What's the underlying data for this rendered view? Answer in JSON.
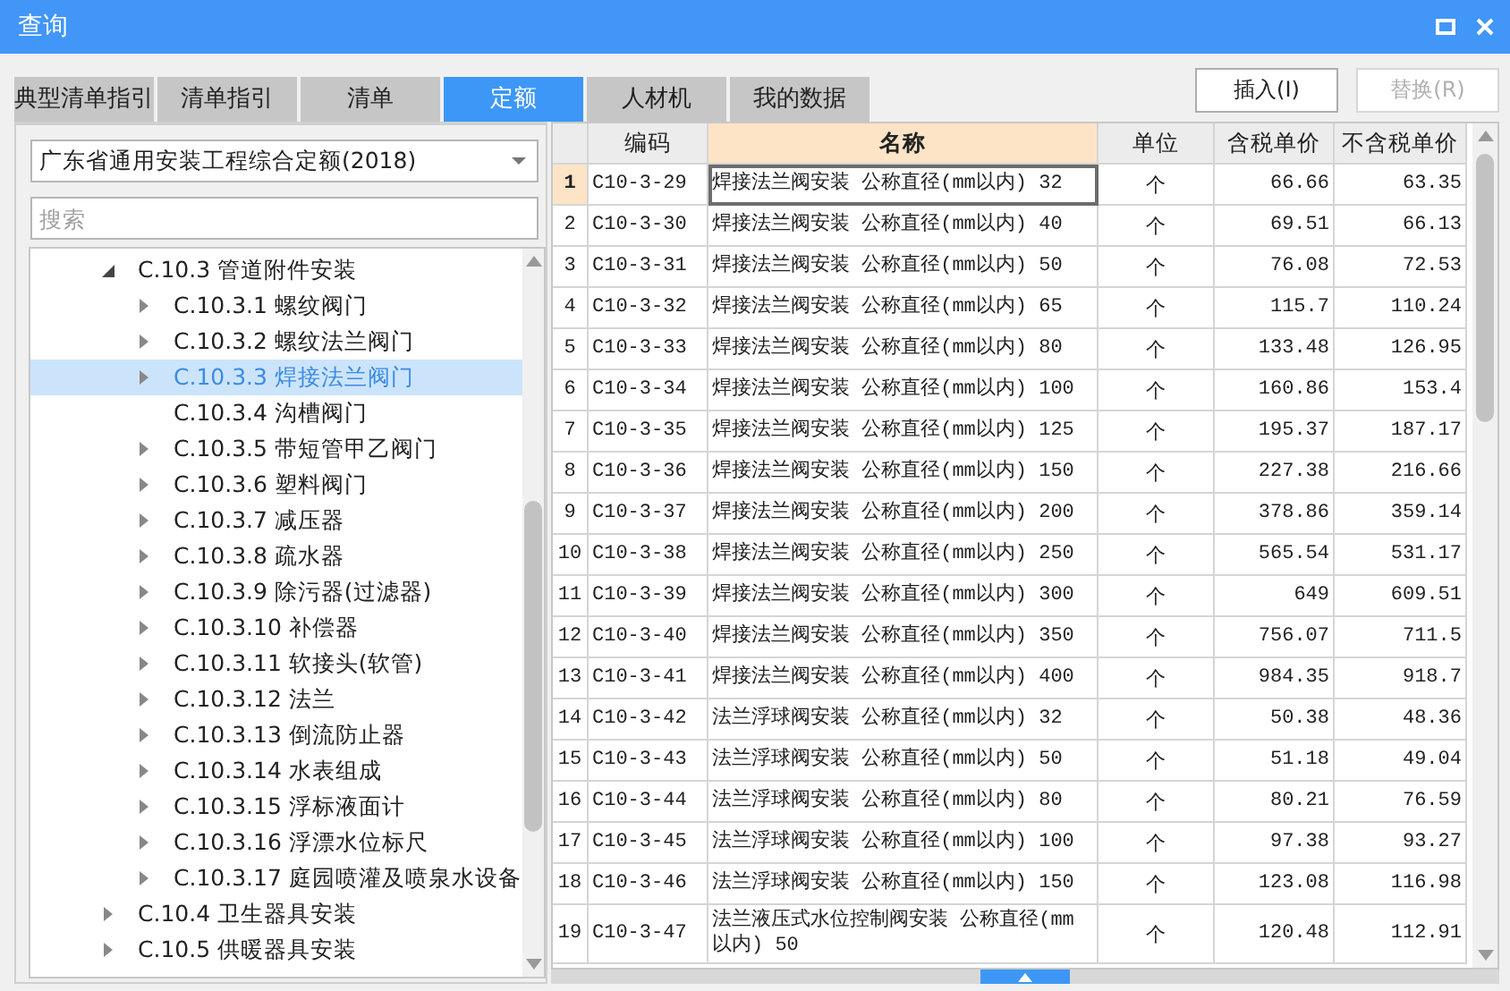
{
  "window": {
    "title": "查询"
  },
  "tabs": [
    {
      "label": "典型清单指引",
      "selected": false
    },
    {
      "label": "清单指引",
      "selected": false
    },
    {
      "label": "清单",
      "selected": false
    },
    {
      "label": "定额",
      "selected": true
    },
    {
      "label": "人材机",
      "selected": false
    },
    {
      "label": "我的数据",
      "selected": false
    }
  ],
  "buttons": [
    {
      "label": "插入(I)",
      "disabled": false
    },
    {
      "label": "替换(R)",
      "disabled": true
    }
  ],
  "library_select": {
    "value": "广东省通用安装工程综合定额(2018)"
  },
  "search": {
    "placeholder": "搜索"
  },
  "tree": [
    {
      "label": "C.10.3 管道附件安装",
      "expandable": true,
      "expanded": true,
      "selected": false,
      "children": [
        {
          "label": "C.10.3.1 螺纹阀门",
          "expandable": true,
          "expanded": false,
          "selected": false
        },
        {
          "label": "C.10.3.2 螺纹法兰阀门",
          "expandable": true,
          "expanded": false,
          "selected": false
        },
        {
          "label": "C.10.3.3 焊接法兰阀门",
          "expandable": true,
          "expanded": false,
          "selected": true
        },
        {
          "label": "C.10.3.4 沟槽阀门",
          "selected": false
        },
        {
          "label": "C.10.3.5 带短管甲乙阀门",
          "expandable": true,
          "expanded": false,
          "selected": false
        },
        {
          "label": "C.10.3.6 塑料阀门",
          "expandable": true,
          "expanded": false,
          "selected": false
        },
        {
          "label": "C.10.3.7 减压器",
          "expandable": true,
          "expanded": false,
          "selected": false
        },
        {
          "label": "C.10.3.8 疏水器",
          "expandable": true,
          "expanded": false,
          "selected": false
        },
        {
          "label": "C.10.3.9 除污器(过滤器)",
          "expandable": true,
          "expanded": false,
          "selected": false
        },
        {
          "label": "C.10.3.10 补偿器",
          "expandable": true,
          "expanded": false,
          "selected": false
        },
        {
          "label": "C.10.3.11 软接头(软管)",
          "expandable": true,
          "expanded": false,
          "selected": false
        },
        {
          "label": "C.10.3.12 法兰",
          "expandable": true,
          "expanded": false,
          "selected": false
        },
        {
          "label": "C.10.3.13 倒流防止器",
          "expandable": true,
          "expanded": false,
          "selected": false
        },
        {
          "label": "C.10.3.14 水表组成",
          "expandable": true,
          "expanded": false,
          "selected": false
        },
        {
          "label": "C.10.3.15 浮标液面计",
          "expandable": true,
          "expanded": false,
          "selected": false
        },
        {
          "label": "C.10.3.16 浮漂水位标尺",
          "expandable": true,
          "expanded": false,
          "selected": false
        },
        {
          "label": "C.10.3.17 庭园喷灌及喷泉水设备",
          "expandable": true,
          "expanded": false,
          "selected": false
        }
      ]
    },
    {
      "label": "C.10.4 卫生器具安装",
      "expandable": true,
      "expanded": false,
      "selected": false
    },
    {
      "label": "C.10.5 供暖器具安装",
      "expandable": true,
      "expanded": false,
      "selected": false
    }
  ],
  "table": {
    "columns": [
      {
        "label": "编码",
        "selected": false
      },
      {
        "label": "名称",
        "selected": true
      },
      {
        "label": "单位",
        "selected": false
      },
      {
        "label": "含税单价",
        "selected": false
      },
      {
        "label": "不含税单价",
        "selected": false
      }
    ],
    "rows": [
      {
        "number": "1",
        "code": "C10-3-29",
        "name": "焊接法兰阀安装 公称直径(mm以内) 32",
        "unit": "个",
        "price_tax": "66.66",
        "price_no_tax": "63.35",
        "selected": true
      },
      {
        "number": "2",
        "code": "C10-3-30",
        "name": "焊接法兰阀安装 公称直径(mm以内) 40",
        "unit": "个",
        "price_tax": "69.51",
        "price_no_tax": "66.13",
        "selected": false
      },
      {
        "number": "3",
        "code": "C10-3-31",
        "name": "焊接法兰阀安装 公称直径(mm以内) 50",
        "unit": "个",
        "price_tax": "76.08",
        "price_no_tax": "72.53",
        "selected": false
      },
      {
        "number": "4",
        "code": "C10-3-32",
        "name": "焊接法兰阀安装 公称直径(mm以内) 65",
        "unit": "个",
        "price_tax": "115.7",
        "price_no_tax": "110.24",
        "selected": false
      },
      {
        "number": "5",
        "code": "C10-3-33",
        "name": "焊接法兰阀安装 公称直径(mm以内) 80",
        "unit": "个",
        "price_tax": "133.48",
        "price_no_tax": "126.95",
        "selected": false
      },
      {
        "number": "6",
        "code": "C10-3-34",
        "name": "焊接法兰阀安装 公称直径(mm以内) 100",
        "unit": "个",
        "price_tax": "160.86",
        "price_no_tax": "153.4",
        "selected": false
      },
      {
        "number": "7",
        "code": "C10-3-35",
        "name": "焊接法兰阀安装 公称直径(mm以内) 125",
        "unit": "个",
        "price_tax": "195.37",
        "price_no_tax": "187.17",
        "selected": false
      },
      {
        "number": "8",
        "code": "C10-3-36",
        "name": "焊接法兰阀安装 公称直径(mm以内) 150",
        "unit": "个",
        "price_tax": "227.38",
        "price_no_tax": "216.66",
        "selected": false
      },
      {
        "number": "9",
        "code": "C10-3-37",
        "name": "焊接法兰阀安装 公称直径(mm以内) 200",
        "unit": "个",
        "price_tax": "378.86",
        "price_no_tax": "359.14",
        "selected": false
      },
      {
        "number": "10",
        "code": "C10-3-38",
        "name": "焊接法兰阀安装 公称直径(mm以内) 250",
        "unit": "个",
        "price_tax": "565.54",
        "price_no_tax": "531.17",
        "selected": false
      },
      {
        "number": "11",
        "code": "C10-3-39",
        "name": "焊接法兰阀安装 公称直径(mm以内) 300",
        "unit": "个",
        "price_tax": "649",
        "price_no_tax": "609.51",
        "selected": false
      },
      {
        "number": "12",
        "code": "C10-3-40",
        "name": "焊接法兰阀安装 公称直径(mm以内) 350",
        "unit": "个",
        "price_tax": "756.07",
        "price_no_tax": "711.5",
        "selected": false
      },
      {
        "number": "13",
        "code": "C10-3-41",
        "name": "焊接法兰阀安装 公称直径(mm以内) 400",
        "unit": "个",
        "price_tax": "984.35",
        "price_no_tax": "918.7",
        "selected": false
      },
      {
        "number": "14",
        "code": "C10-3-42",
        "name": "法兰浮球阀安装 公称直径(mm以内) 32",
        "unit": "个",
        "price_tax": "50.38",
        "price_no_tax": "48.36",
        "selected": false
      },
      {
        "number": "15",
        "code": "C10-3-43",
        "name": "法兰浮球阀安装 公称直径(mm以内) 50",
        "unit": "个",
        "price_tax": "51.18",
        "price_no_tax": "49.04",
        "selected": false
      },
      {
        "number": "16",
        "code": "C10-3-44",
        "name": "法兰浮球阀安装 公称直径(mm以内) 80",
        "unit": "个",
        "price_tax": "80.21",
        "price_no_tax": "76.59",
        "selected": false
      },
      {
        "number": "17",
        "code": "C10-3-45",
        "name": "法兰浮球阀安装 公称直径(mm以内) 100",
        "unit": "个",
        "price_tax": "97.38",
        "price_no_tax": "93.27",
        "selected": false
      },
      {
        "number": "18",
        "code": "C10-3-46",
        "name": "法兰浮球阀安装 公称直径(mm以内) 150",
        "unit": "个",
        "price_tax": "123.08",
        "price_no_tax": "116.98",
        "selected": false
      },
      {
        "number": "19",
        "code": "C10-3-47",
        "name": "法兰液压式水位控制阀安装 公称直径(mm以内) 50",
        "unit": "个",
        "price_tax": "120.48",
        "price_no_tax": "112.91",
        "selected": false
      }
    ]
  }
}
